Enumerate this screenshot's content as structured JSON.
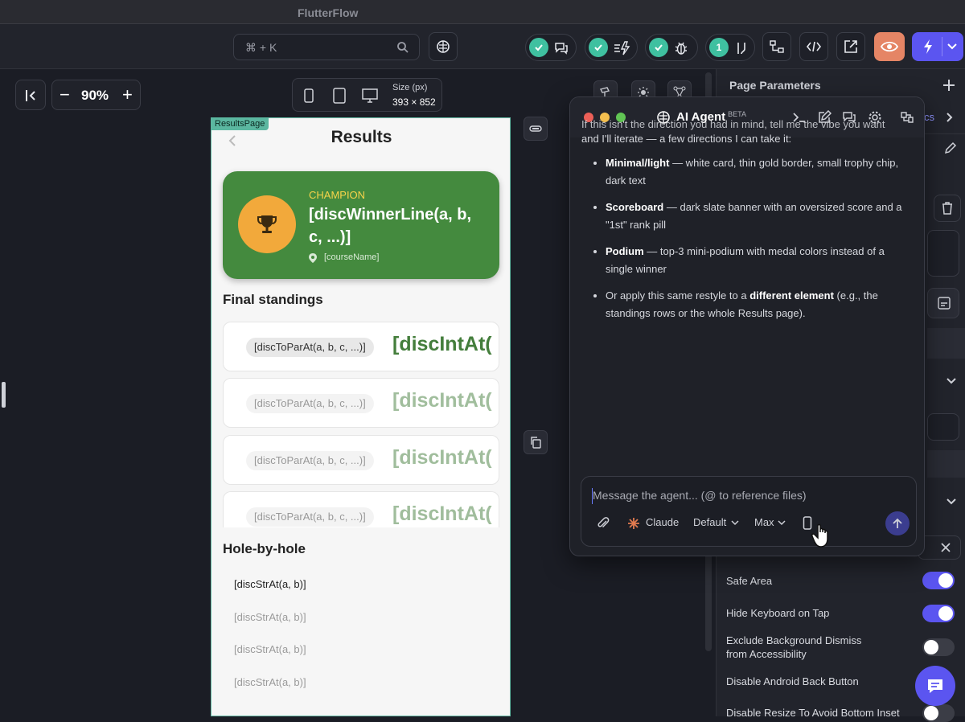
{
  "app": {
    "window_title": "FlutterFlow"
  },
  "toolbar": {
    "search_shortcut": "⌘ + K",
    "checks_badge": "1"
  },
  "canvas": {
    "zoom": "90%",
    "size_label": "Size (px)",
    "size_value": "393 × 852"
  },
  "phone": {
    "page_tag": "ResultsPage",
    "title": "Results",
    "champion_label": "CHAMPION",
    "champion_line": "[discWinnerLine(a, b, c, ...)]",
    "course_name": "[courseName]",
    "final_standings_heading": "Final standings",
    "standings": [
      {
        "par": "[discToParAt(a, b, c, ...)]",
        "score": "[discIntAt("
      },
      {
        "par": "[discToParAt(a, b, c, ...)]",
        "score": "[discIntAt("
      },
      {
        "par": "[discToParAt(a, b, c, ...)]",
        "score": "[discIntAt("
      },
      {
        "par": "[discToParAt(a, b, c, ...)]",
        "score": "[discIntAt("
      }
    ],
    "hole_heading": "Hole-by-hole",
    "holes": [
      "[discStrAt(a, b)]",
      "[discStrAt(a, b)]",
      "[discStrAt(a, b)]",
      "[discStrAt(a, b)]"
    ]
  },
  "right_panel": {
    "title": "Page Parameters",
    "partial_tab": "cs",
    "toggles": [
      {
        "label": "Safe Area",
        "on": true
      },
      {
        "label": "Hide Keyboard on Tap",
        "on": true
      },
      {
        "label": "Exclude Background Dismiss from Accessibility",
        "on": false
      },
      {
        "label": "Disable Android Back Button",
        "on": false
      },
      {
        "label": "Disable Resize To Avoid Bottom Inset",
        "on": false
      }
    ]
  },
  "agent": {
    "title": "AI Agent",
    "beta": "BETA",
    "intro_partial": "If this isn't the direction you had in mind, tell me the vibe you want",
    "intro_rest": "and I'll iterate — a few directions I can take it:",
    "options": [
      {
        "bold": "Minimal/light",
        "text": " — white card, thin gold border, small trophy chip, dark text"
      },
      {
        "bold": "Scoreboard",
        "text": " — dark slate banner with an oversized score and a \"1st\" rank pill"
      },
      {
        "bold": "Podium",
        "text": " — top-3 mini-podium with medal colors instead of a single winner"
      },
      {
        "pre": "Or apply this same restyle to a ",
        "bold": "different element",
        "text": " (e.g., the standings rows or the whole Results page)."
      }
    ],
    "composer": {
      "placeholder": "Message the agent... (@ to reference files)",
      "model": "Claude",
      "mode": "Default",
      "effort": "Max"
    }
  },
  "colors": {
    "accent": "#5b55f0",
    "champion_green": "#448a3e",
    "trophy_orange": "#f2a93b",
    "teal": "#3fc0a0"
  }
}
